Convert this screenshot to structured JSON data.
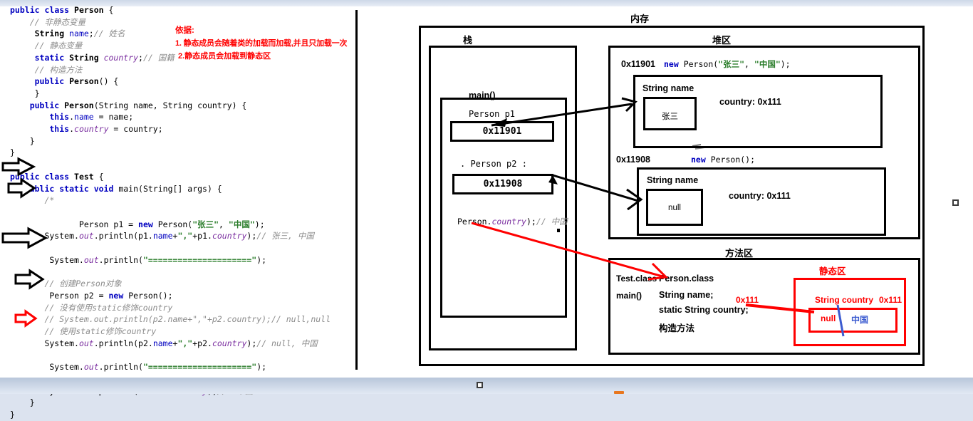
{
  "code": {
    "lines": [
      [
        {
          "t": "public ",
          "c": "kw"
        },
        {
          "t": "class ",
          "c": "kw"
        },
        {
          "t": "Person",
          "c": "typ"
        },
        {
          "t": " {",
          "c": "pln"
        }
      ],
      [
        {
          "t": "    // 非静态变量",
          "c": "cmt"
        }
      ],
      [
        {
          "t": "     String ",
          "c": "typ"
        },
        {
          "t": "name",
          "c": "fld"
        },
        {
          "t": ";",
          "c": "pln"
        },
        {
          "t": "// 姓名",
          "c": "cmt"
        }
      ],
      [
        {
          "t": "     // 静态变量",
          "c": "cmt"
        }
      ],
      [
        {
          "t": "     static ",
          "c": "kw"
        },
        {
          "t": "String ",
          "c": "typ"
        },
        {
          "t": "country",
          "c": "stat"
        },
        {
          "t": ";",
          "c": "pln"
        },
        {
          "t": "// 国籍",
          "c": "cmt"
        }
      ],
      [
        {
          "t": "     // 构造方法",
          "c": "cmt"
        }
      ],
      [
        {
          "t": "     public ",
          "c": "kw"
        },
        {
          "t": "Person",
          "c": "typ"
        },
        {
          "t": "() {",
          "c": "pln"
        }
      ],
      [
        {
          "t": "     }",
          "c": "pln"
        }
      ],
      [
        {
          "t": "    public ",
          "c": "kw"
        },
        {
          "t": "Person",
          "c": "typ"
        },
        {
          "t": "(String name, String country) {",
          "c": "pln"
        }
      ],
      [
        {
          "t": "        this",
          "c": "kw"
        },
        {
          "t": ".",
          "c": "pln"
        },
        {
          "t": "name ",
          "c": "fld"
        },
        {
          "t": "= name;",
          "c": "pln"
        }
      ],
      [
        {
          "t": "        this",
          "c": "kw"
        },
        {
          "t": ".",
          "c": "pln"
        },
        {
          "t": "country ",
          "c": "stat"
        },
        {
          "t": "= country;",
          "c": "pln"
        }
      ],
      [
        {
          "t": "    }",
          "c": "pln"
        }
      ],
      [
        {
          "t": "}",
          "c": "pln"
        }
      ],
      [
        {
          "t": "",
          "c": "pln"
        }
      ],
      [
        {
          "t": "public ",
          "c": "kw"
        },
        {
          "t": "class ",
          "c": "kw"
        },
        {
          "t": "Test",
          "c": "typ"
        },
        {
          "t": " {",
          "c": "pln"
        }
      ],
      [
        {
          "t": "   public static void ",
          "c": "kw"
        },
        {
          "t": "main",
          "c": "pln"
        },
        {
          "t": "(String[] args) {",
          "c": "pln"
        }
      ],
      [
        {
          "t": "       /*",
          "c": "cmt"
        }
      ],
      [
        {
          "t": "",
          "c": "pln"
        }
      ],
      [
        {
          "t": "              Person p1 = ",
          "c": "pln"
        },
        {
          "t": "new ",
          "c": "kw"
        },
        {
          "t": "Person(",
          "c": "pln"
        },
        {
          "t": "\"张三\"",
          "c": "str"
        },
        {
          "t": ", ",
          "c": "pln"
        },
        {
          "t": "\"中国\"",
          "c": "str"
        },
        {
          "t": ");",
          "c": "pln"
        }
      ],
      [
        {
          "t": "       System.",
          "c": "pln"
        },
        {
          "t": "out",
          "c": "stat"
        },
        {
          "t": ".println(p1.",
          "c": "pln"
        },
        {
          "t": "name",
          "c": "fld"
        },
        {
          "t": "+",
          "c": "pln"
        },
        {
          "t": "\",\"",
          "c": "str"
        },
        {
          "t": "+p1.",
          "c": "pln"
        },
        {
          "t": "country",
          "c": "stat"
        },
        {
          "t": ");",
          "c": "pln"
        },
        {
          "t": "// 张三, 中国",
          "c": "cmt"
        }
      ],
      [
        {
          "t": "",
          "c": "pln"
        }
      ],
      [
        {
          "t": "        System.",
          "c": "pln"
        },
        {
          "t": "out",
          "c": "stat"
        },
        {
          "t": ".println(",
          "c": "pln"
        },
        {
          "t": "\"=====================\"",
          "c": "str"
        },
        {
          "t": ");",
          "c": "pln"
        }
      ],
      [
        {
          "t": "",
          "c": "pln"
        }
      ],
      [
        {
          "t": "       // 创建Person对象",
          "c": "cmt"
        }
      ],
      [
        {
          "t": "        Person p2 = ",
          "c": "pln"
        },
        {
          "t": "new ",
          "c": "kw"
        },
        {
          "t": "Person();",
          "c": "pln"
        }
      ],
      [
        {
          "t": "       // 没有使用static修饰country",
          "c": "cmt"
        }
      ],
      [
        {
          "t": "       // System.out.println(p2.name+\",\"+p2.country);// null,null",
          "c": "cmt"
        }
      ],
      [
        {
          "t": "       // 使用static修饰country",
          "c": "cmt"
        }
      ],
      [
        {
          "t": "       System.",
          "c": "pln"
        },
        {
          "t": "out",
          "c": "stat"
        },
        {
          "t": ".println(p2.",
          "c": "pln"
        },
        {
          "t": "name",
          "c": "fld"
        },
        {
          "t": "+",
          "c": "pln"
        },
        {
          "t": "\",\"",
          "c": "str"
        },
        {
          "t": "+p2.",
          "c": "pln"
        },
        {
          "t": "country",
          "c": "stat"
        },
        {
          "t": ");",
          "c": "pln"
        },
        {
          "t": "// null, 中国",
          "c": "cmt"
        }
      ],
      [
        {
          "t": "",
          "c": "pln"
        }
      ],
      [
        {
          "t": "        System.",
          "c": "pln"
        },
        {
          "t": "out",
          "c": "stat"
        },
        {
          "t": ".println(",
          "c": "pln"
        },
        {
          "t": "\"=====================\"",
          "c": "str"
        },
        {
          "t": ");",
          "c": "pln"
        }
      ],
      [
        {
          "t": "",
          "c": "pln"
        }
      ],
      [
        {
          "t": "       System.",
          "c": "pln"
        },
        {
          "t": "out",
          "c": "stat"
        },
        {
          "t": ".println(Person.",
          "c": "pln"
        },
        {
          "t": "country",
          "c": "stat"
        },
        {
          "t": ");",
          "c": "pln"
        },
        {
          "t": "//  中国",
          "c": "cmt"
        }
      ],
      [
        {
          "t": "    }",
          "c": "pln"
        }
      ],
      [
        {
          "t": "}",
          "c": "pln"
        }
      ]
    ]
  },
  "red_note": {
    "title": "依据:",
    "point1": "1. 静态成员会随着类的加载而加载,并且只加载一次",
    "point2": "2.静态成员会加载到静态区",
    "color": "#ff0000"
  },
  "memory": {
    "title": "内存",
    "stack": {
      "title": "栈",
      "frame_label": "main()",
      "slots": [
        {
          "var": "Person p1",
          "value": "0x11901"
        },
        {
          "var": ".  Person p2 :",
          "value": "0x11908"
        }
      ],
      "pasted_snippet": {
        "part1": "Person.",
        "part2": "country",
        "part3": ");",
        "part4": "// 中国"
      }
    },
    "heap": {
      "title": "堆区",
      "objects": [
        {
          "address": "0x11901",
          "expr_new": "new ",
          "expr_rest_a": "Person(",
          "expr_str1": "\"张三\"",
          "expr_comma": ", ",
          "expr_str2": "\"中国\"",
          "expr_rest_b": ");",
          "field_label": "String name",
          "field_value": "张三",
          "country_field": "country: 0x111"
        },
        {
          "address": "0x11908",
          "expr_new": "new ",
          "expr_rest_a": "Person();",
          "expr_str1": "",
          "expr_comma": "",
          "expr_str2": "",
          "expr_rest_b": "",
          "field_label": "String name",
          "field_value": "null",
          "country_field": "country: 0x111"
        }
      ]
    },
    "method_area": {
      "title": "方法区",
      "left_col": [
        "Test.class",
        "main()"
      ],
      "right_col": [
        "Person.class",
        "String name;",
        "static String country;",
        "构造方法"
      ],
      "pointer_label": "0x111",
      "static_area": {
        "title": "静态区",
        "field_label": "String country",
        "field_address": "0x111",
        "value_null": "null",
        "value_actual": "中国"
      }
    }
  },
  "colors": {
    "accent_red": "#ff0000",
    "accent_blue": "#3b5bd0",
    "string_green": "#2a7d2a",
    "keyword_blue": "#0000c0",
    "static_purple": "#7b2fa0",
    "comment_gray": "#8c8c8c"
  }
}
